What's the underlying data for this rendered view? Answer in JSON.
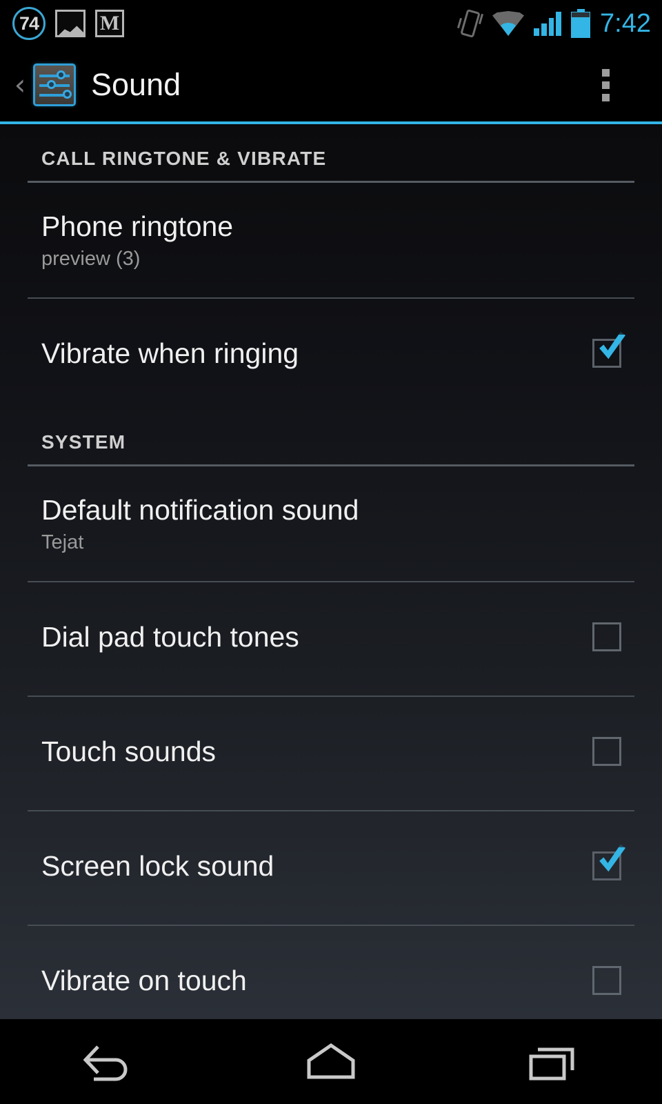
{
  "status_bar": {
    "notification_badge": "74",
    "icons": [
      "photo-icon",
      "gmail-icon",
      "vibrate-icon",
      "wifi-icon",
      "cellular-signal-icon",
      "battery-icon"
    ],
    "time": "7:42",
    "accent_color": "#33b5e5"
  },
  "action_bar": {
    "back_label": "‹",
    "app_icon": "settings-sliders-icon",
    "title": "Sound",
    "overflow_label": "More options"
  },
  "sections": [
    {
      "header": "CALL RINGTONE & VIBRATE",
      "rows": [
        {
          "title": "Phone ringtone",
          "summary": "preview (3)",
          "type": "navigation"
        },
        {
          "title": "Vibrate when ringing",
          "summary": "",
          "type": "checkbox",
          "checked": true
        }
      ]
    },
    {
      "header": "SYSTEM",
      "rows": [
        {
          "title": "Default notification sound",
          "summary": "Tejat",
          "type": "navigation"
        },
        {
          "title": "Dial pad touch tones",
          "summary": "",
          "type": "checkbox",
          "checked": false
        },
        {
          "title": "Touch sounds",
          "summary": "",
          "type": "checkbox",
          "checked": false
        },
        {
          "title": "Screen lock sound",
          "summary": "",
          "type": "checkbox",
          "checked": true
        },
        {
          "title": "Vibrate on touch",
          "summary": "",
          "type": "checkbox",
          "checked": false
        }
      ]
    }
  ],
  "nav_bar": {
    "back": "back-icon",
    "home": "home-icon",
    "recents": "recents-icon"
  }
}
